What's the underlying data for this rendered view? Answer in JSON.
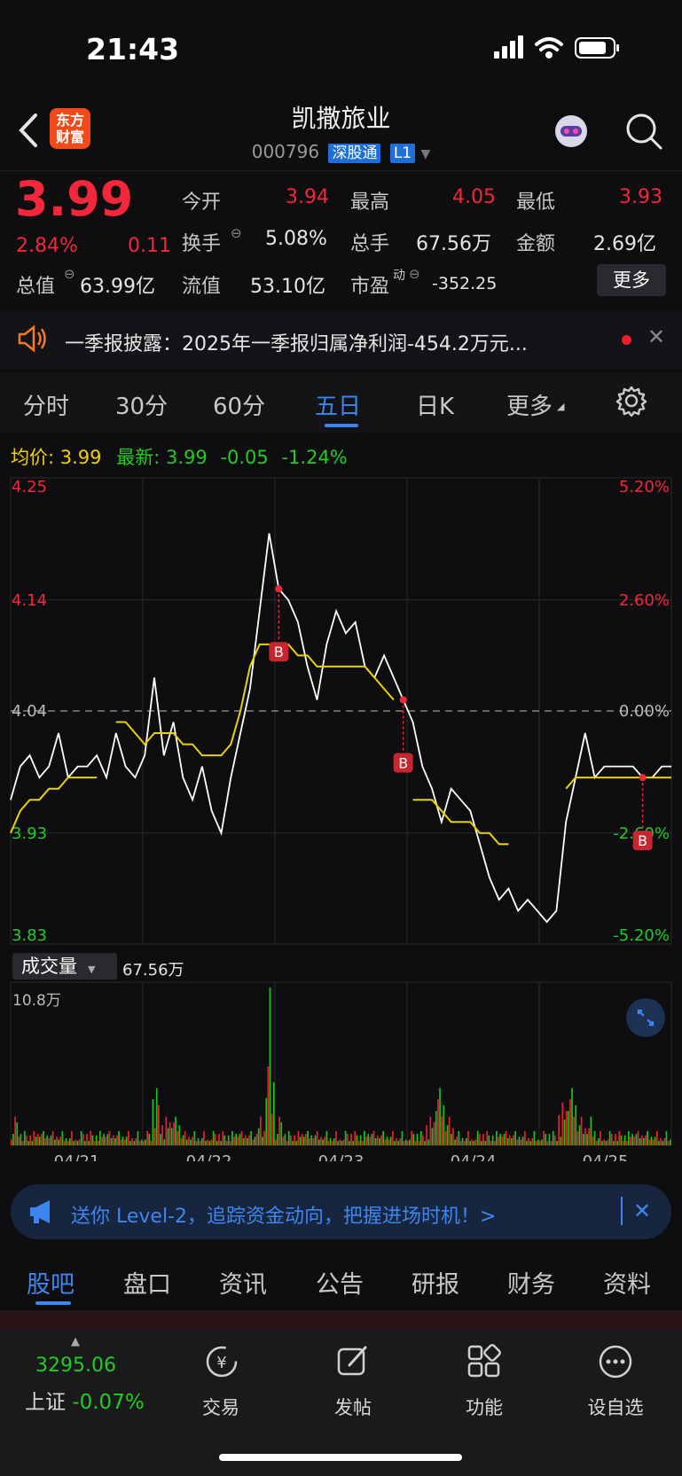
{
  "status": {
    "time": "21:43"
  },
  "header": {
    "logo_line1": "东方",
    "logo_line2": "财富",
    "stock_name": "凯撒旅业",
    "stock_code": "000796",
    "market_tag": "深股通",
    "level_tag": "L1"
  },
  "quote": {
    "price": "3.99",
    "change_pct": "2.84%",
    "change_amt": "0.11",
    "open_label": "今开",
    "open_value": "3.94",
    "high_label": "最高",
    "high_value": "4.05",
    "low_label": "最低",
    "low_value": "3.93",
    "turnover_label": "换手",
    "turnover_value": "5.08%",
    "volume_label": "总手",
    "volume_value": "67.56万",
    "amount_label": "金额",
    "amount_value": "2.69亿",
    "mcap_label": "总值",
    "mcap_value": "63.99亿",
    "float_label": "流值",
    "float_value": "53.10亿",
    "pe_label": "市盈",
    "pe_sup": "动",
    "pe_value": "-352.25",
    "more_label": "更多"
  },
  "notice": {
    "text": "一季报披露：2025年一季报归属净利润-454.2万元..."
  },
  "chart_tabs": [
    "分时",
    "30分",
    "60分",
    "五日",
    "日K",
    "更多"
  ],
  "active_chart_tab": "五日",
  "intraday": {
    "avg_label": "均价:",
    "avg_value": "3.99",
    "latest_label": "最新:",
    "latest_value": "3.99",
    "latest_change": "-0.05",
    "latest_pct": "-1.24%"
  },
  "chart_data": {
    "type": "line",
    "y_left_ticks": [
      "4.25",
      "4.14",
      "4.04",
      "3.93",
      "3.83"
    ],
    "y_right_ticks": [
      "5.20%",
      "2.60%",
      "0.00%",
      "-2.60%",
      "-5.20%"
    ],
    "ylim": [
      3.83,
      4.25
    ],
    "x_dates": [
      "04/21",
      "04/22",
      "04/23",
      "04/24",
      "04/25"
    ],
    "series": [
      {
        "name": "price",
        "color": "#ffffff",
        "values": [
          3.96,
          3.99,
          4.0,
          3.98,
          3.99,
          4.02,
          3.98,
          3.99,
          3.99,
          4.0,
          3.98,
          4.02,
          3.99,
          3.98,
          4.0,
          4.07,
          4.0,
          4.03,
          3.98,
          3.96,
          3.99,
          3.95,
          3.93,
          3.98,
          4.02,
          4.06,
          4.13,
          4.2,
          4.15,
          4.14,
          4.12,
          4.08,
          4.05,
          4.1,
          4.13,
          4.11,
          4.12,
          4.08,
          4.07,
          4.09,
          4.07,
          4.05,
          4.03,
          3.99,
          3.97,
          3.94,
          3.97,
          3.96,
          3.95,
          3.92,
          3.89,
          3.87,
          3.88,
          3.86,
          3.87,
          3.86,
          3.85,
          3.86,
          3.94,
          3.98,
          4.02,
          3.98,
          3.99,
          3.99,
          3.99,
          3.99,
          3.98,
          3.98,
          3.99,
          3.99
        ]
      },
      {
        "name": "avg",
        "color": "#e8d200",
        "values": [
          3.93,
          3.95,
          3.96,
          3.96,
          3.97,
          3.97,
          3.98,
          3.98,
          3.98,
          3.98,
          null,
          4.03,
          4.03,
          4.02,
          4.01,
          4.02,
          4.02,
          4.02,
          4.01,
          4.01,
          4.0,
          4.0,
          4.0,
          4.01,
          4.04,
          4.08,
          4.1,
          4.1,
          4.1,
          4.1,
          4.09,
          4.09,
          4.08,
          4.08,
          4.08,
          4.08,
          4.08,
          4.08,
          4.07,
          4.06,
          4.05,
          null,
          3.96,
          3.96,
          3.96,
          3.95,
          3.94,
          3.94,
          3.94,
          3.93,
          3.93,
          3.92,
          3.92,
          null,
          null,
          null,
          null,
          null,
          3.97,
          3.98,
          3.98,
          3.98,
          3.98,
          3.98,
          3.98,
          3.98,
          3.98,
          3.98,
          3.98,
          3.98
        ]
      }
    ],
    "volume_label": "成交量",
    "volume_total": "67.56万",
    "volume_max": "10.8万",
    "volume_values": [
      2,
      1,
      1,
      1,
      1,
      1,
      1,
      1,
      1,
      1,
      1,
      1,
      1,
      1,
      1,
      4,
      2,
      2,
      1,
      1,
      1,
      1,
      1,
      1,
      1,
      1,
      2,
      11,
      2,
      1,
      1,
      1,
      1,
      1,
      1,
      1,
      1,
      1,
      1,
      1,
      1,
      1,
      1,
      1,
      2,
      4,
      2,
      1,
      1,
      1,
      1,
      1,
      1,
      1,
      1,
      1,
      1,
      1,
      3,
      4,
      2,
      2,
      1,
      1,
      1,
      1,
      1,
      1,
      1,
      1
    ]
  },
  "promo": {
    "text": "送你 Level-2，追踪资金动向，把握进场时机！>"
  },
  "bottom_tabs": [
    "股吧",
    "盘口",
    "资讯",
    "公告",
    "研报",
    "财务",
    "资料"
  ],
  "dock": {
    "index_value": "3295.06",
    "index_name": "上证",
    "index_change": "-0.07%",
    "items": [
      "交易",
      "发帖",
      "功能",
      "设自选"
    ]
  }
}
